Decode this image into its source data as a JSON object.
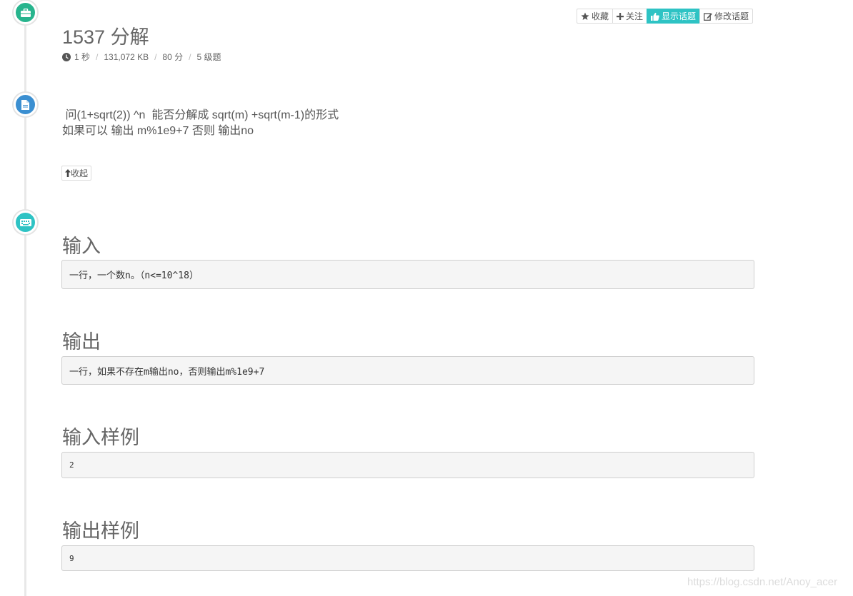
{
  "problem": {
    "title": "1537 分解",
    "meta": [
      "1 秒",
      "131,072 KB",
      "80 分",
      "5 级题"
    ],
    "description": [
      " 问(1+sqrt(2)) ^n  能否分解成 sqrt(m) +sqrt(m-1)的形式",
      "如果可以 输出 m%1e9+7 否则 输出no"
    ]
  },
  "toolbar": {
    "favorite": "收藏",
    "follow": "关注",
    "show_topics": "显示话题",
    "edit_topics": "修改话题"
  },
  "collapse_label": "收起",
  "sections": {
    "input": {
      "title": "输入",
      "content": "一行，一个数n。（n<=10^18）"
    },
    "output": {
      "title": "输出",
      "content": "一行，如果不存在m输出no，否则输出m%1e9+7"
    },
    "sample_input": {
      "title": "输入样例",
      "content": "2"
    },
    "sample_output": {
      "title": "输出样例",
      "content": "9"
    }
  },
  "watermark": "https://blog.csdn.net/Anoy_acer",
  "colors": {
    "accent": "#2ec3c4",
    "green": "#27b48d",
    "blue": "#3b8fd1"
  },
  "icons": [
    "briefcase-icon",
    "document-icon",
    "keyboard-icon",
    "star-icon",
    "plus-icon",
    "thumbs-up-icon",
    "edit-icon",
    "clock-icon",
    "arrow-up-icon"
  ]
}
